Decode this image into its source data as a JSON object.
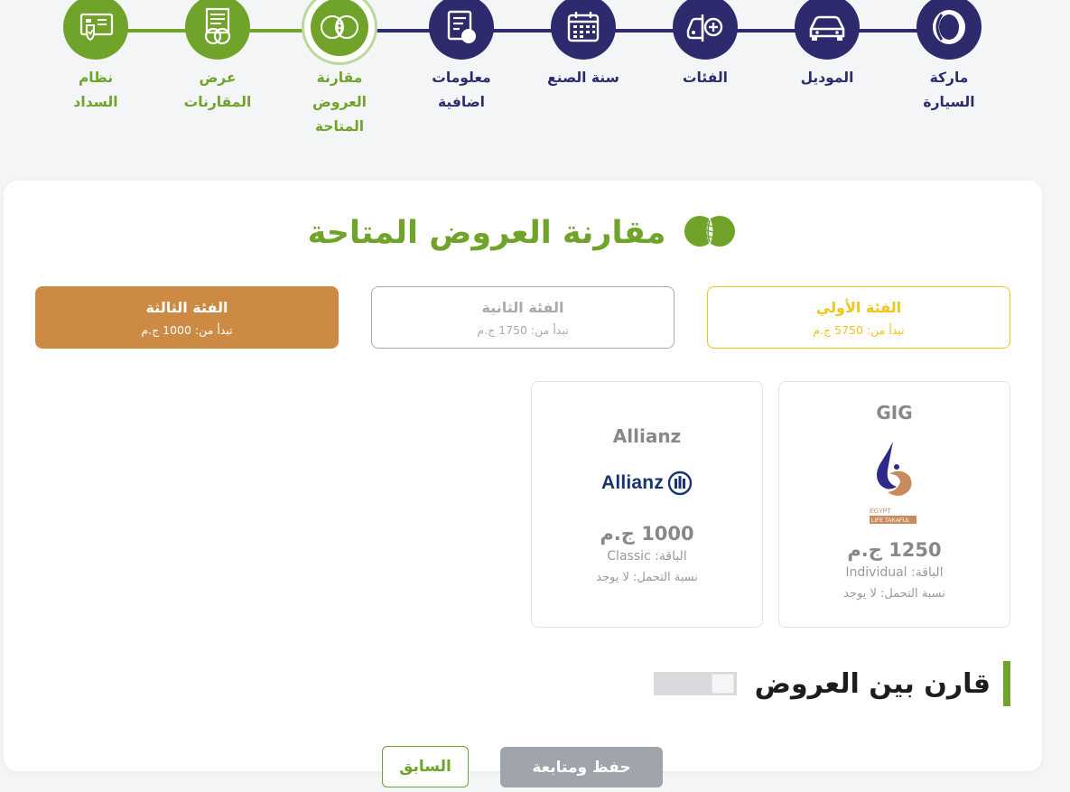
{
  "stepper": {
    "steps": [
      {
        "label": "نظام السداد",
        "state": "done",
        "icon": "payment-card-shield-icon"
      },
      {
        "label": "عرض المقارنات",
        "state": "done",
        "icon": "compare-document-icon"
      },
      {
        "label": "مقارنة العروض المتاحة",
        "state": "current",
        "icon": "compare-offers-icon"
      },
      {
        "label": "معلومات اضافية",
        "state": "todo",
        "icon": "info-form-icon"
      },
      {
        "label": "سنة الصنع",
        "state": "todo",
        "icon": "calendar-icon"
      },
      {
        "label": "الفئات",
        "state": "todo",
        "icon": "car-category-icon"
      },
      {
        "label": "الموديل",
        "state": "todo",
        "icon": "car-model-icon"
      },
      {
        "label": "ماركة السيارة",
        "state": "todo",
        "icon": "car-brand-icon"
      }
    ]
  },
  "card": {
    "title": "مقارنة العروض المتاحة",
    "tiers": {
      "first": {
        "name": "الفئة الأولي",
        "price": "تبدأ من: 5750 ج.م"
      },
      "second": {
        "name": "الفئة الثانية",
        "price": "تبدأ من: 1750 ج.م"
      },
      "third": {
        "name": "الفئة الثالثة",
        "price": "تبدأ من: 1000 ج.م"
      }
    },
    "offers": {
      "gig": {
        "name": "GIG",
        "logo_line1": "EGYPT",
        "logo_line2": "LIFE TAKAFUL",
        "price": "1250 ج.م",
        "package": "الباقة: Individual",
        "deductible": "نسبة التحمل: لا يوجد"
      },
      "allianz": {
        "name": "Allianz",
        "logo_text": "Allianz",
        "price": "1000 ج.م",
        "package": "الباقة: Classic",
        "deductible": "نسبة التحمل: لا يوجد"
      }
    },
    "compare_label": "قارن بين العروض",
    "compare_enabled": false
  },
  "buttons": {
    "save_continue": "حفظ ومتابعة",
    "previous": "السابق"
  },
  "colors": {
    "green": "#6fa32a",
    "navy": "#2d2a6e",
    "gold": "#f0c419",
    "orange": "#cd8a45",
    "grey_button": "#9fa4ab"
  }
}
